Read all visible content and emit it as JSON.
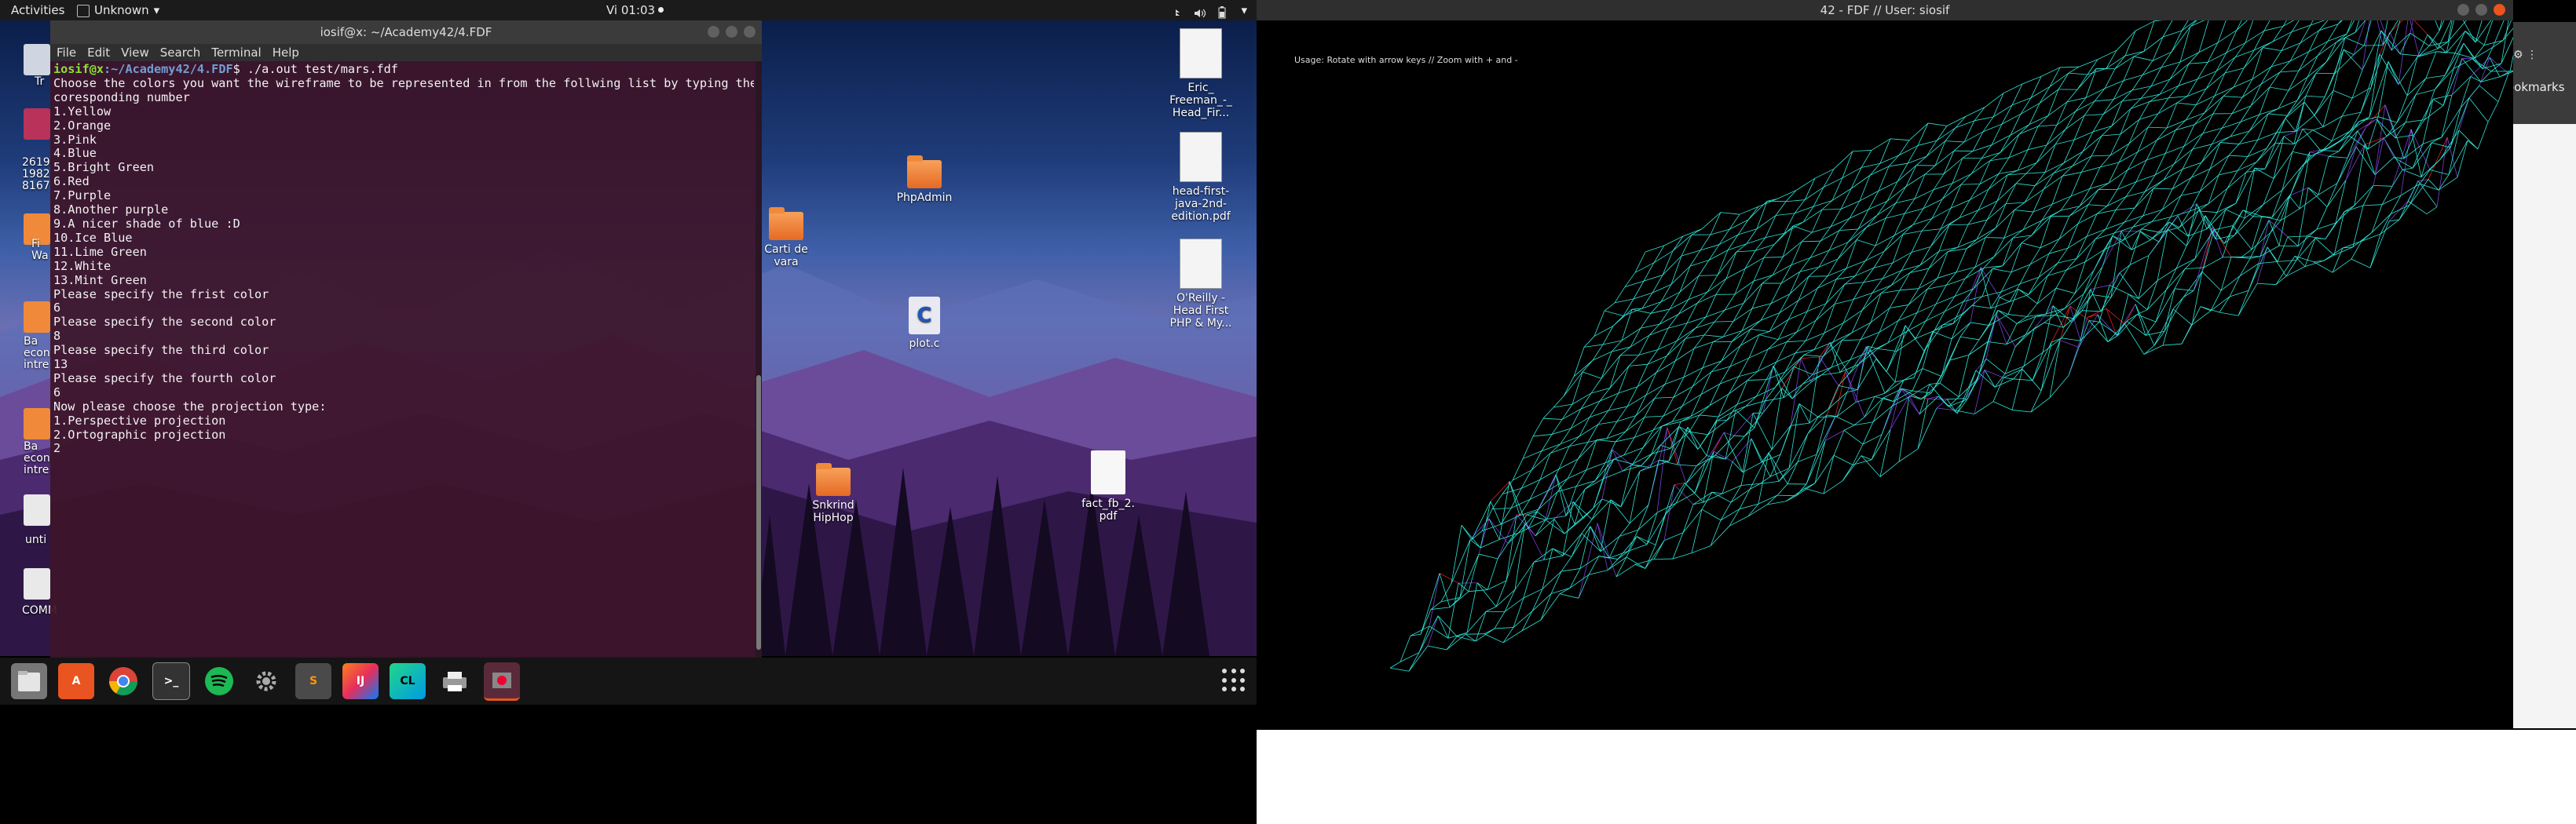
{
  "topbar": {
    "activities": "Activities",
    "app_menu": "Unknown",
    "clock": "Vi 01:03"
  },
  "left_partial_icons": [
    {
      "label": "Tr"
    },
    {
      "label": "2619\n1982\n8167"
    },
    {
      "label": "Fi\nWa"
    },
    {
      "label": "Ba\necon\nintre"
    },
    {
      "label": "Ba\necon\nintre"
    },
    {
      "label": "unti"
    },
    {
      "label": "COMM"
    }
  ],
  "terminal": {
    "title": "iosif@x: ~/Academy42/4.FDF",
    "menu": [
      "File",
      "Edit",
      "View",
      "Search",
      "Terminal",
      "Help"
    ],
    "prompt_user": "iosif@x",
    "prompt_path": ":~/Academy42/4.FDF",
    "command": "$ ./a.out test/mars.fdf",
    "lines": [
      "Choose the colors you want the wireframe to be represented in from the follwing list by typing the",
      "coresponding number",
      "1.Yellow",
      "2.Orange",
      "3.Pink",
      "4.Blue",
      "5.Bright Green",
      "6.Red",
      "7.Purple",
      "8.Another purple",
      "9.A nicer shade of blue :D",
      "10.Ice Blue",
      "11.Lime Green",
      "12.White",
      "13.Mint Green",
      "Please specify the frist color",
      "6",
      "Please specify the second color",
      "8",
      "Please specify the third color",
      "13",
      "Please specify the fourth color",
      "6",
      "Now please choose the projection type:",
      "1.Perspective projection",
      "2.Ortographic projection",
      "2"
    ]
  },
  "desktop_icons": [
    {
      "label": "PhpAdmin",
      "kind": "folder-icon"
    },
    {
      "label": "Carti de\nvara",
      "kind": "folder-icon"
    },
    {
      "label": "plot.c",
      "kind": "c-file-icon"
    },
    {
      "label": "Snkrind\nHipHop",
      "kind": "folder-icon"
    },
    {
      "label": "fact_fb_2.\npdf",
      "kind": "document-icon"
    },
    {
      "label": "Eric_\nFreeman_-_\nHead_Fir...",
      "kind": "book-icon"
    },
    {
      "label": "head-first-\njava-2nd-\nedition.pdf",
      "kind": "book-icon"
    },
    {
      "label": "O'Reilly -\nHead First\nPHP & My...",
      "kind": "book-icon"
    }
  ],
  "dock": {
    "items": [
      "files-icon",
      "software-icon",
      "chrome-icon",
      "terminal-icon",
      "spotify-icon",
      "settings-icon",
      "sublime-icon",
      "intellij-icon",
      "clion-icon",
      "printer-icon",
      "fdf-app-icon"
    ]
  },
  "fdf": {
    "title": "42 - FDF // User: siosif",
    "usage": "Usage: Rotate with arrow keys // Zoom with + and -",
    "colors": {
      "primary": "#2ee6d6",
      "secondary": "#e0231c",
      "tertiary": "#7a3fd8"
    }
  },
  "behind": {
    "bookmarks": "ookmarks"
  }
}
